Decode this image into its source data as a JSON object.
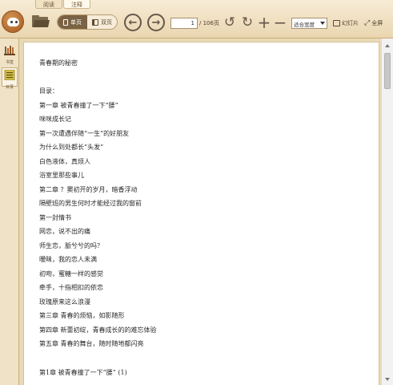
{
  "tabs": [
    {
      "label": "阅读"
    },
    {
      "label": "注释"
    }
  ],
  "toolbar": {
    "single_page_label": "单页",
    "double_page_label": "双页",
    "page_input_value": "1",
    "page_total": "/ 106页",
    "zoom_value": "适合宽度",
    "slideshow_label": "幻灯片",
    "fullscreen_label": "全屏"
  },
  "rail": {
    "items": [
      {
        "label": "书签",
        "icon": "bookshelf-icon"
      },
      {
        "label": "目录",
        "icon": "toc-icon"
      }
    ]
  },
  "document": {
    "title": "青春期的秘密",
    "toc_heading": "目录：",
    "lines": [
      "第一章  被青春撞了一下“腰”",
      "咪咪成长记",
      "第一次遭遇伴随“一生”的好朋友",
      "为什么到处都长“头发”",
      "白色液体，真烦人",
      "浴室里那些事儿",
      "第二章  ？窦初开的岁月，暗香浮动",
      "隔壁班的男生何时才能经过我的窗前",
      "第一封情书",
      "网恋，说不出的痛",
      "师生恋，脈兮兮的吗？",
      "暧昧，我的恋人未满",
      "初吻，蜜糖一样的感觉",
      "牵手，十指相扣的依恋",
      "玫瑰原来这么浪漫",
      "第三章  青春的烦恼，如影随形",
      "第四章  新蕾初绽，青春成长的的难忘体验",
      "第五章  青春的舞台，随时随地都闪亮"
    ],
    "chapter_heading": "第1章  被青春撞了一下“腰”    (1)"
  },
  "colors": {
    "toolbar_bg": "#ead6b0",
    "accent_brown": "#7a6344",
    "page_bg": "#ffffff"
  }
}
